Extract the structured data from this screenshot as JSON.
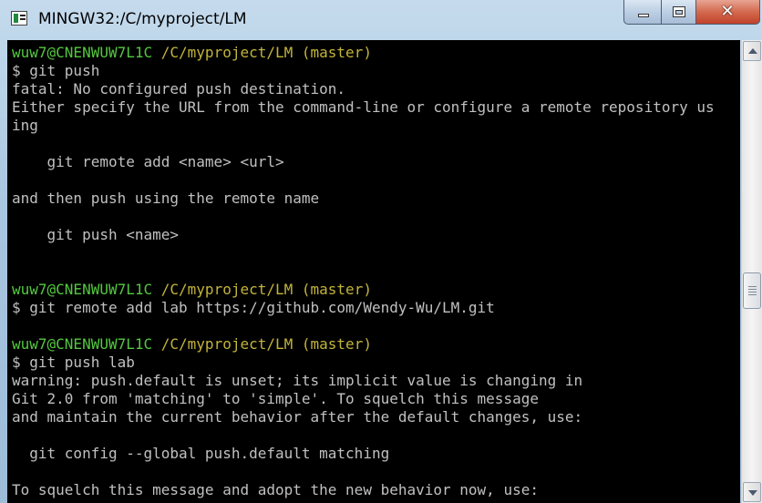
{
  "window": {
    "title": "MINGW32:/C/myproject/LM",
    "icons": {
      "app": "terminal-app-icon",
      "minimize": "minimize-icon",
      "maximize": "maximize-icon",
      "close": "close-icon"
    },
    "close_glyph": "✕"
  },
  "colors": {
    "prompt_user": "#53c83f",
    "prompt_path": "#c3b43a",
    "text": "#c0c0c0",
    "background": "#000000"
  },
  "terminal": {
    "lines": [
      [
        {
          "t": "wuw7@CNENWUW7L1C ",
          "c": "green"
        },
        {
          "t": "/C/myproject/LM (master)",
          "c": "olive"
        }
      ],
      [
        {
          "t": "$ git push"
        }
      ],
      [
        {
          "t": "fatal: No configured push destination."
        }
      ],
      [
        {
          "t": "Either specify the URL from the command-line or configure a remote repository us"
        }
      ],
      [
        {
          "t": "ing"
        }
      ],
      [],
      [
        {
          "t": "    git remote add <name> <url>"
        }
      ],
      [],
      [
        {
          "t": "and then push using the remote name"
        }
      ],
      [],
      [
        {
          "t": "    git push <name>"
        }
      ],
      [],
      [],
      [
        {
          "t": "wuw7@CNENWUW7L1C ",
          "c": "green"
        },
        {
          "t": "/C/myproject/LM (master)",
          "c": "olive"
        }
      ],
      [
        {
          "t": "$ git remote add lab https://github.com/Wendy-Wu/LM.git"
        }
      ],
      [],
      [
        {
          "t": "wuw7@CNENWUW7L1C ",
          "c": "green"
        },
        {
          "t": "/C/myproject/LM (master)",
          "c": "olive"
        }
      ],
      [
        {
          "t": "$ git push lab"
        }
      ],
      [
        {
          "t": "warning: push.default is unset; its implicit value is changing in"
        }
      ],
      [
        {
          "t": "Git 2.0 from 'matching' to 'simple'. To squelch this message"
        }
      ],
      [
        {
          "t": "and maintain the current behavior after the default changes, use:"
        }
      ],
      [],
      [
        {
          "t": "  git config --global push.default matching"
        }
      ],
      [],
      [
        {
          "t": "To squelch this message and adopt the new behavior now, use:"
        }
      ]
    ]
  },
  "scrollbar": {
    "up_icon": "scroll-up-arrow-icon",
    "down_icon": "scroll-down-arrow-icon",
    "position": 0.55
  }
}
